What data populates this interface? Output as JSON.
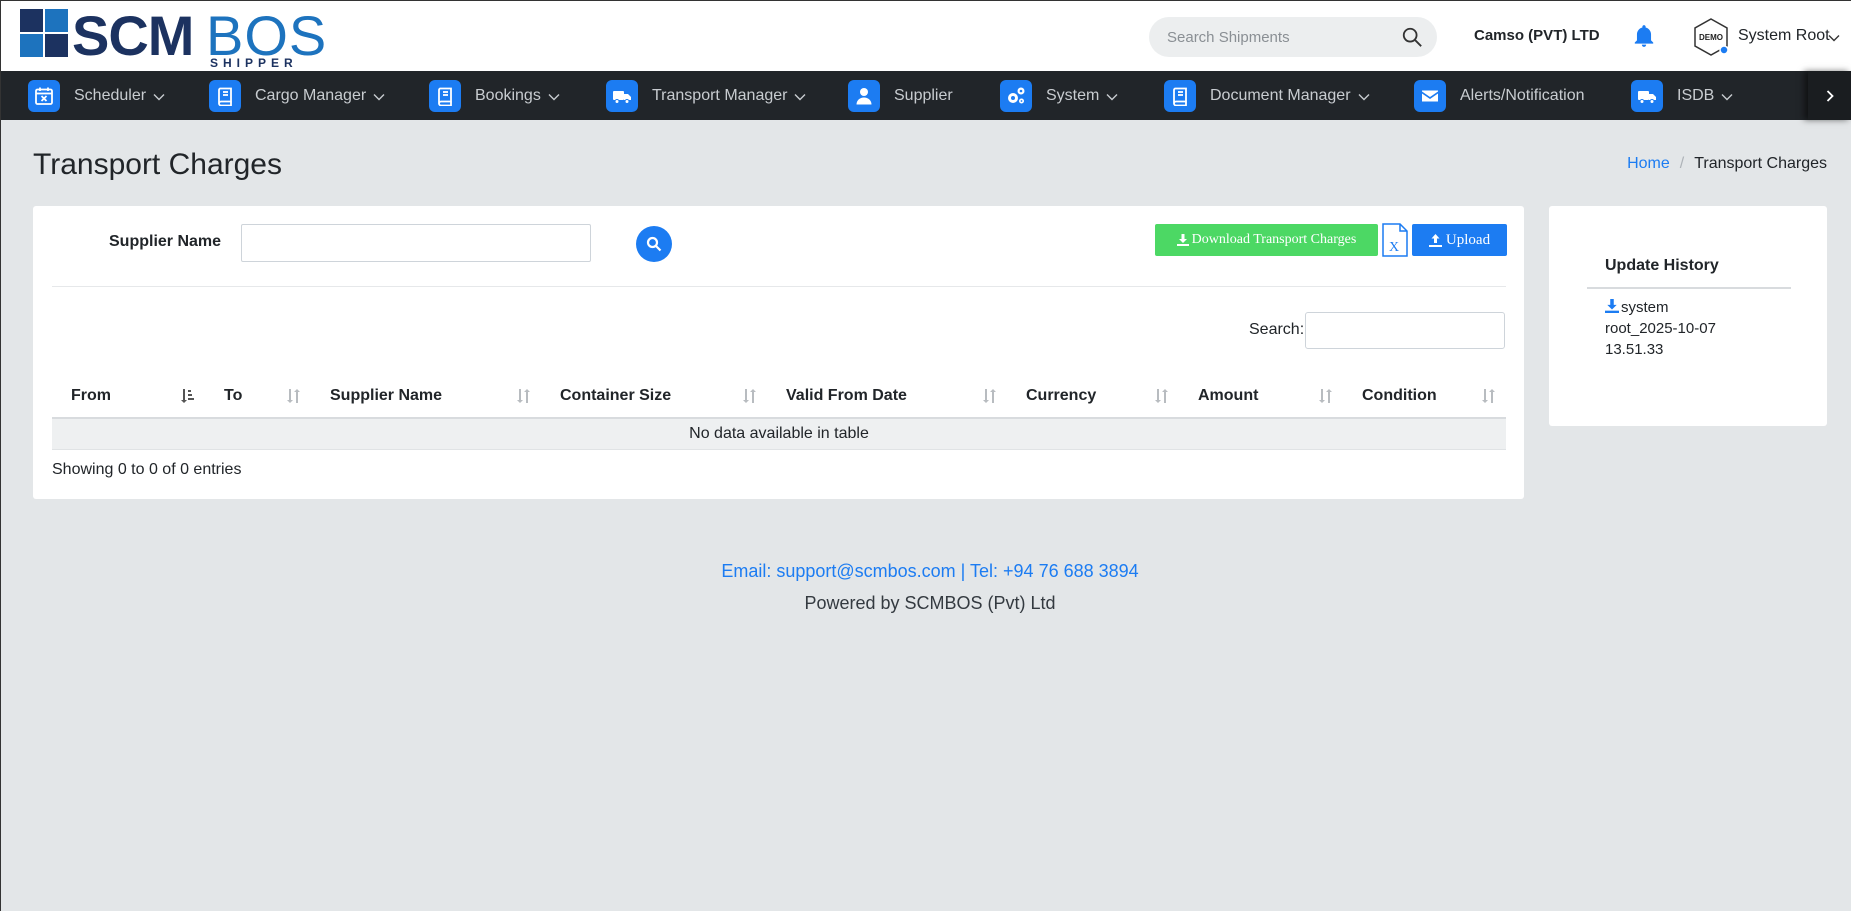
{
  "logo": {
    "main": "SCM",
    "accent": "BOS",
    "sub": "SHIPPER"
  },
  "header": {
    "search_placeholder": "Search Shipments",
    "company": "Camso (PVT) LTD",
    "avatar_text": "DEMO",
    "user_name": "System Root"
  },
  "nav": {
    "items": [
      {
        "label": "Scheduler",
        "icon": "calendar-x-icon",
        "dropdown": true
      },
      {
        "label": "Cargo Manager",
        "icon": "book-icon",
        "dropdown": true
      },
      {
        "label": "Bookings",
        "icon": "book-icon",
        "dropdown": true
      },
      {
        "label": "Transport Manager",
        "icon": "truck-icon",
        "dropdown": true
      },
      {
        "label": "Supplier",
        "icon": "user-icon",
        "dropdown": false
      },
      {
        "label": "System",
        "icon": "gears-icon",
        "dropdown": true
      },
      {
        "label": "Document Manager",
        "icon": "book-icon",
        "dropdown": true
      },
      {
        "label": "Alerts/Notification",
        "icon": "envelope-icon",
        "dropdown": false
      },
      {
        "label": "ISDB",
        "icon": "truck-icon",
        "dropdown": true
      }
    ]
  },
  "page": {
    "title": "Transport Charges",
    "breadcrumb": {
      "home": "Home",
      "current": "Transport Charges"
    }
  },
  "filter": {
    "supplier_label": "Supplier Name",
    "supplier_value": "",
    "download_label": "Download Transport Charges",
    "upload_label": "Upload"
  },
  "table": {
    "search_label": "Search:",
    "search_value": "",
    "columns": [
      "From",
      "To",
      "Supplier Name",
      "Container Size",
      "Valid From Date",
      "Currency",
      "Amount",
      "Condition"
    ],
    "empty_message": "No data available in table",
    "info": "Showing 0 to 0 of 0 entries"
  },
  "history": {
    "title": "Update History",
    "entries": [
      "system root_2025-10-07 13.51.33"
    ]
  },
  "footer": {
    "contact": "Email: support@scmbos.com | Tel: +94 76 688 3894",
    "powered": "Powered by SCMBOS (Pvt) Ltd"
  },
  "colors": {
    "primary": "#1c7cf2",
    "success": "#4cd864",
    "nav_bg": "#212529",
    "page_bg": "#e3e6e8",
    "logo_dark": "#1c3260",
    "logo_blue": "#1d73be"
  }
}
